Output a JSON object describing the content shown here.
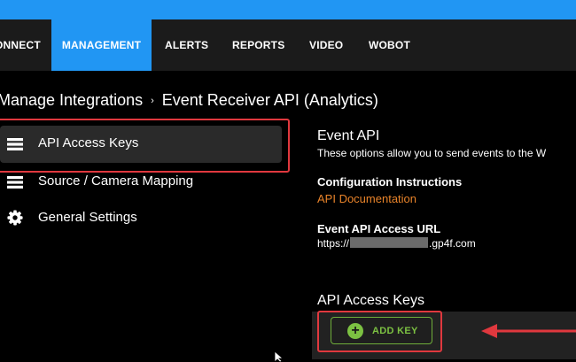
{
  "nav": {
    "items": [
      {
        "label": "ONNECT",
        "active": false
      },
      {
        "label": "MANAGEMENT",
        "active": true
      },
      {
        "label": "ALERTS",
        "active": false
      },
      {
        "label": "REPORTS",
        "active": false
      },
      {
        "label": "VIDEO",
        "active": false
      },
      {
        "label": "WOBOT",
        "active": false
      }
    ]
  },
  "breadcrumb": {
    "parent": "Manage Integrations",
    "separator": "›",
    "current": "Event Receiver API (Analytics)"
  },
  "sidebar": {
    "items": [
      {
        "label": "API Access Keys",
        "icon": "list-icon",
        "active": true
      },
      {
        "label": "Source / Camera Mapping",
        "icon": "list-icon",
        "active": false
      },
      {
        "label": "General Settings",
        "icon": "gear-icon",
        "active": false
      }
    ]
  },
  "event_api": {
    "title": "Event API",
    "description": "These options allow you to send events to the W",
    "config_label": "Configuration Instructions",
    "doc_link": "API Documentation",
    "url_label": "Event API Access URL",
    "url_prefix": "https://",
    "url_suffix": ".gp4f.com"
  },
  "keys": {
    "title": "API Access Keys",
    "add_button": "ADD KEY"
  },
  "colors": {
    "accent": "#2196f3",
    "highlight": "#e0383e",
    "link": "#e8832a",
    "add_green": "#7cc142"
  }
}
